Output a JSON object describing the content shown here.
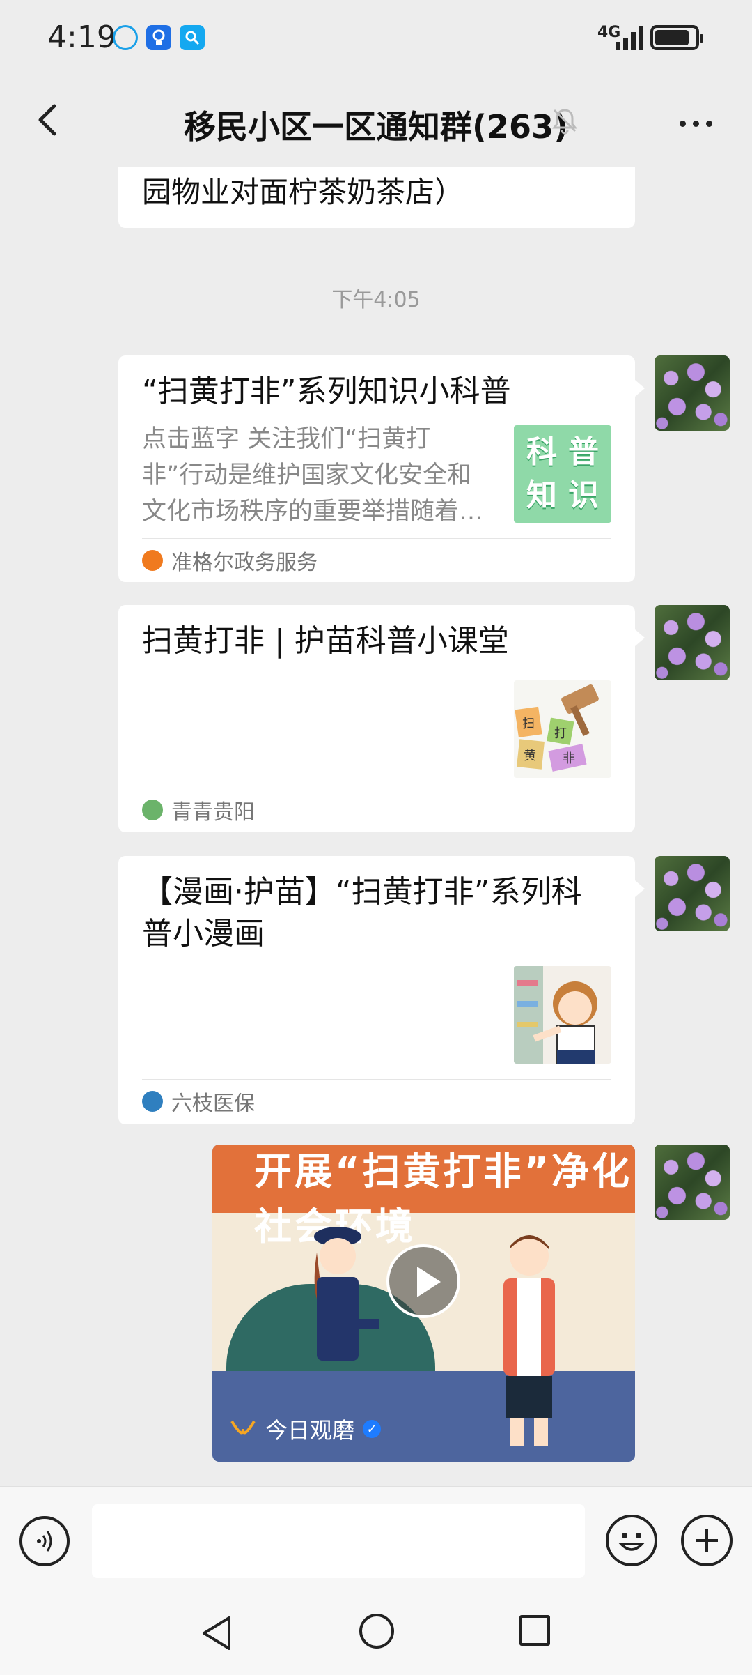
{
  "status_bar": {
    "time": "4:19",
    "network": "4G",
    "notification_icons": [
      "cloud-icon",
      "lightbulb-icon",
      "search-app-icon"
    ],
    "battery_icon": "battery-icon"
  },
  "header": {
    "back_icon": "chevron-left-icon",
    "title": "移民小区一区通知群(263)",
    "mute_icon": "bell-off-icon",
    "more_icon": "more-dots-icon"
  },
  "chat": {
    "previous_message_tail": "园物业对面柠茶奶茶店）",
    "timestamp": "下午4:05",
    "messages": [
      {
        "type": "article",
        "title": "“扫黄打非”系列知识小科普",
        "description": "点击蓝字 关注我们“扫黄打非”行动是维护国家文化安全和文化市场秩序的重要举措随着…",
        "thumb_text": [
          "科",
          "普",
          "知",
          "识"
        ],
        "source": "准格尔政务服务",
        "source_color": "#f07a1e"
      },
      {
        "type": "article",
        "title": "扫黄打非 | 护苗科普小课堂",
        "source": "青青贵阳",
        "source_color": "#6bb36a",
        "thumb_labels": [
          "扫",
          "打",
          "黄",
          "非"
        ]
      },
      {
        "type": "article",
        "title": "【漫画·护苗】“扫黄打非”系列科普小漫画",
        "source": "六枝医保",
        "source_color": "#2f7fbf"
      },
      {
        "type": "video",
        "banner_text": "开展“扫黄打非”净化社会环境",
        "channel": "今日观磨",
        "verified": true
      }
    ]
  },
  "input_bar": {
    "voice_icon": "voice-icon",
    "placeholder": "",
    "emoji_icon": "emoji-icon",
    "plus_icon": "plus-icon"
  },
  "nav_bar": {
    "back_icon": "nav-back-icon",
    "home_icon": "nav-home-icon",
    "recent_icon": "nav-recent-icon"
  }
}
